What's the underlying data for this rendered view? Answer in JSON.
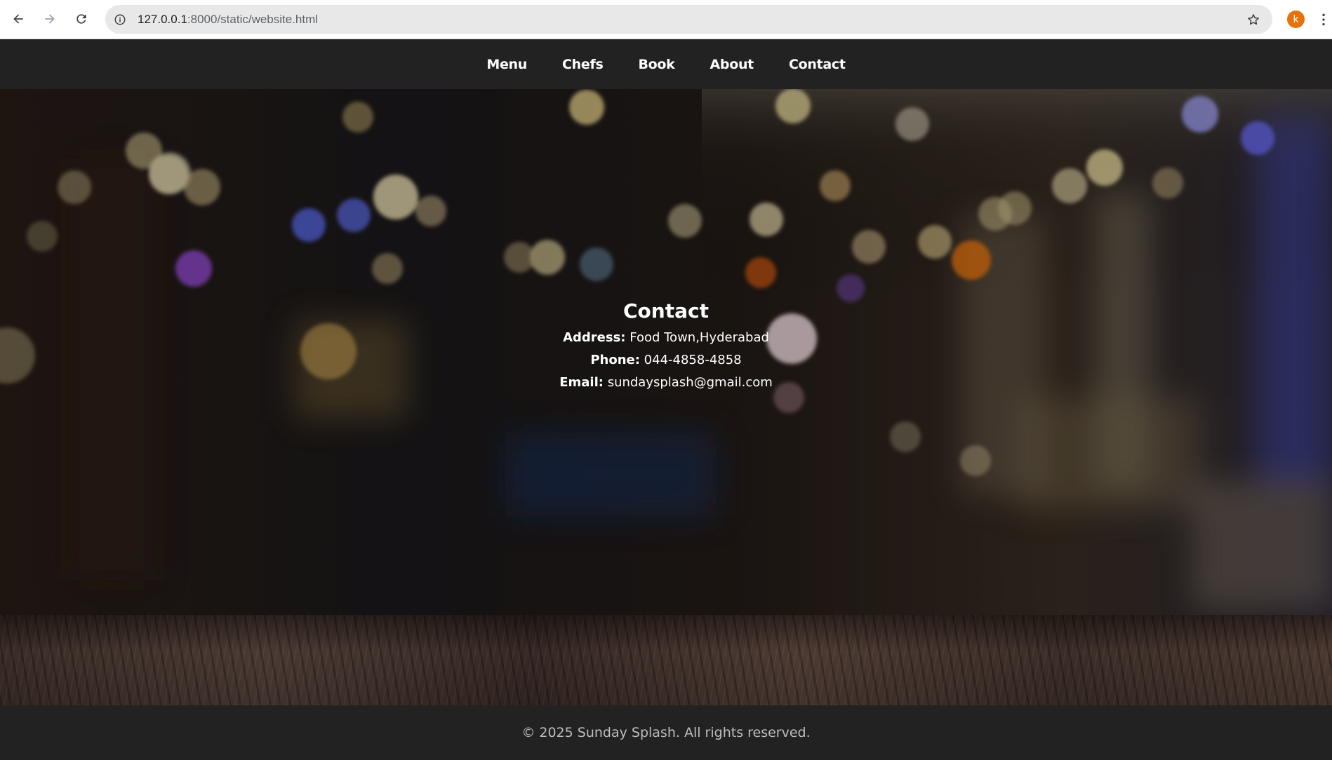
{
  "browser": {
    "url_host": "127.0.0.1",
    "url_path": ":8000/static/website.html",
    "avatar_letter": "k",
    "icons": [
      "back-arrow-icon",
      "forward-arrow-icon",
      "reload-icon",
      "site-info-icon",
      "bookmark-star-icon",
      "more-vert-icon"
    ]
  },
  "nav": {
    "items": [
      {
        "label": "Menu"
      },
      {
        "label": "Chefs"
      },
      {
        "label": "Book"
      },
      {
        "label": "About"
      },
      {
        "label": "Contact"
      }
    ]
  },
  "contact": {
    "title": "Contact",
    "address_label": "Address:",
    "address_value": "Food Town,Hyderabad",
    "phone_label": "Phone:",
    "phone_value": "044-4858-4858",
    "email_label": "Email:",
    "email_value": "sundaysplash@gmail.com"
  },
  "footer": {
    "text": "© 2025 Sunday Splash. All rights reserved."
  },
  "colors": {
    "nav_bg": "#222222",
    "avatar": "#e8710a",
    "text": "#ffffff"
  }
}
